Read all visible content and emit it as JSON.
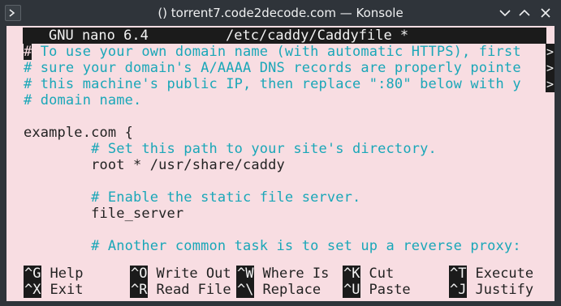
{
  "window": {
    "title": "() torrent7.code2decode.com — Konsole"
  },
  "nano": {
    "version": "GNU nano 6.4",
    "filename": "/etc/caddy/Caddyfile *",
    "lines": [
      {
        "text": " To use your own domain name (with automatic HTTPS), first",
        "cursor": "#",
        "type": "comment",
        "overflow": true
      },
      {
        "text": "# sure your domain's A/AAAA DNS records are properly pointe",
        "type": "comment",
        "overflow": true
      },
      {
        "text": "# this machine's public IP, then replace \":80\" below with y",
        "type": "comment",
        "overflow": true
      },
      {
        "text": "# domain name.",
        "type": "comment",
        "overflow": false
      },
      {
        "text": "",
        "type": "plain",
        "overflow": false
      },
      {
        "text": "example.com {",
        "type": "plain",
        "overflow": false
      },
      {
        "text": "        # Set this path to your site's directory.",
        "type": "comment",
        "overflow": false
      },
      {
        "text": "        root * /usr/share/caddy",
        "type": "plain",
        "overflow": false
      },
      {
        "text": "",
        "type": "plain",
        "overflow": false
      },
      {
        "text": "        # Enable the static file server.",
        "type": "comment",
        "overflow": false
      },
      {
        "text": "        file_server",
        "type": "plain",
        "overflow": false
      },
      {
        "text": "",
        "type": "plain",
        "overflow": false
      },
      {
        "text": "        # Another common task is to set up a reverse proxy:",
        "type": "comment",
        "overflow": false
      }
    ],
    "shortcuts_row1": [
      {
        "key": "^G",
        "label": "Help"
      },
      {
        "key": "^O",
        "label": "Write Out"
      },
      {
        "key": "^W",
        "label": "Where Is"
      },
      {
        "key": "^K",
        "label": "Cut"
      },
      {
        "key": "^T",
        "label": "Execute"
      }
    ],
    "shortcuts_row2": [
      {
        "key": "^X",
        "label": "Exit"
      },
      {
        "key": "^R",
        "label": "Read File"
      },
      {
        "key": "^\\",
        "label": "Replace"
      },
      {
        "key": "^U",
        "label": "Paste"
      },
      {
        "key": "^J",
        "label": "Justify"
      }
    ],
    "overflow_glyph": ">"
  },
  "colors": {
    "terminal_bg": "#f8dde2",
    "comment": "#1aa7b8",
    "titlebar": "#2f343a"
  },
  "icons": [
    "konsole-menu-icon",
    "chevron-down-icon",
    "chevron-up-icon",
    "close-icon"
  ]
}
